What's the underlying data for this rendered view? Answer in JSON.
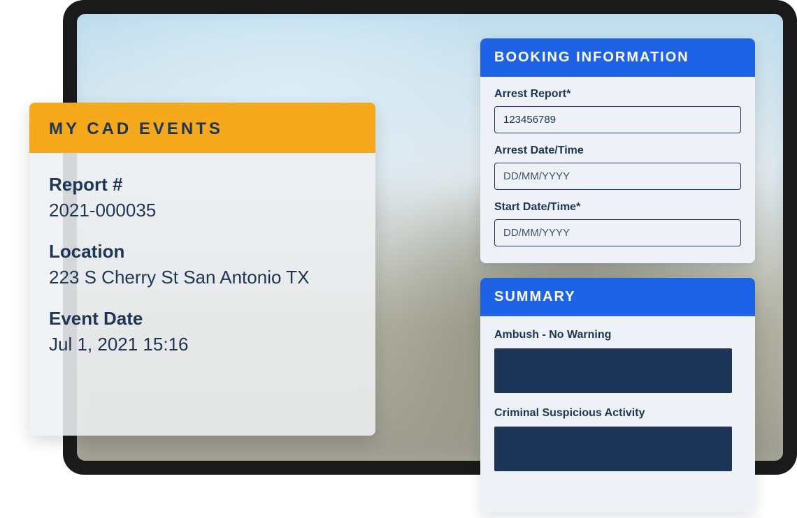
{
  "cad_events": {
    "title": "MY CAD EVENTS",
    "fields": {
      "report": {
        "label": "Report #",
        "value": "2021-000035"
      },
      "location": {
        "label": "Location",
        "value": "223 S Cherry St San Antonio TX"
      },
      "event_date": {
        "label": "Event Date",
        "value": "Jul 1, 2021 15:16"
      }
    }
  },
  "booking": {
    "title": "BOOKING INFORMATION",
    "fields": {
      "arrest_report": {
        "label": "Arrest Report*",
        "value": "123456789"
      },
      "arrest_datetime": {
        "label": "Arrest Date/Time",
        "placeholder": "DD/MM/YYYY"
      },
      "start_datetime": {
        "label": "Start Date/Time*",
        "placeholder": "DD/MM/YYYY"
      }
    }
  },
  "summary": {
    "title": "SUMMARY",
    "items": [
      {
        "label": "Ambush - No Warning"
      },
      {
        "label": "Criminal Suspicious Activity"
      }
    ]
  }
}
